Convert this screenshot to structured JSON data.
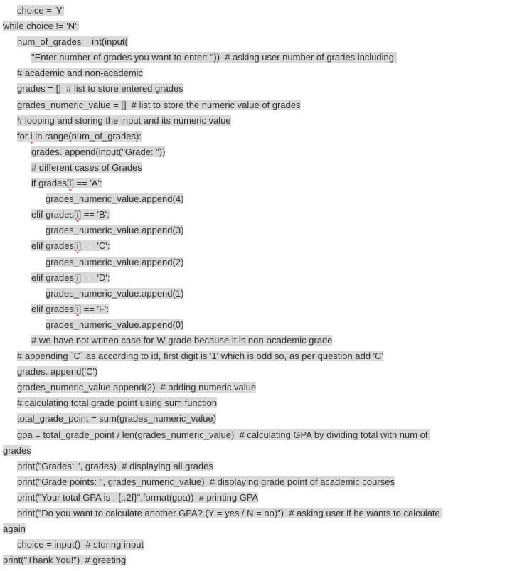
{
  "lines": [
    {
      "indent": 1,
      "text": "choice = 'Y'"
    },
    {
      "indent": 0,
      "text": "while choice != 'N':"
    },
    {
      "indent": 1,
      "text": "num_of_grades = int(input("
    },
    {
      "indent": 2,
      "text": "\"Enter number of grades you want to enter: \"))  # asking user number of grades including "
    },
    {
      "indent": 1,
      "text": "# academic and non-academic"
    },
    {
      "indent": 1,
      "text": "grades = []  # list to store entered grades"
    },
    {
      "indent": 1,
      "text": "grades_numeric_value = []  # list to store the numeric value of grades"
    },
    {
      "indent": 1,
      "text": "# looping and storing the input and its numeric value"
    },
    {
      "indent": 1,
      "text": "for i in range(num_of_grades):",
      "spellIdx": 4
    },
    {
      "indent": 2,
      "text": "grades. append(input(\"Grade: \"))"
    },
    {
      "indent": 2,
      "text": "# different cases of Grades"
    },
    {
      "indent": 2,
      "text": "if grades[i] == 'A':",
      "spellIdx": 10
    },
    {
      "indent": 3,
      "text": "grades_numeric_value.append(4)"
    },
    {
      "indent": 2,
      "text": "elif grades[i] == 'B':",
      "spellIdx": 12
    },
    {
      "indent": 3,
      "text": "grades_numeric_value.append(3)"
    },
    {
      "indent": 2,
      "text": "elif grades[i] == 'C':",
      "spellIdx": 12
    },
    {
      "indent": 3,
      "text": "grades_numeric_value.append(2)"
    },
    {
      "indent": 2,
      "text": "elif grades[i] == 'D':",
      "spellIdx": 12
    },
    {
      "indent": 3,
      "text": "grades_numeric_value.append(1)"
    },
    {
      "indent": 2,
      "text": "elif grades[i] == 'F':",
      "spellIdx": 12
    },
    {
      "indent": 3,
      "text": "grades_numeric_value.append(0)"
    },
    {
      "indent": 2,
      "text": "# we have not written case for W grade because it is non-academic grade"
    },
    {
      "indent": 1,
      "text": "# appending `C` as according to id, first digit is '1' which is odd so, as per question add 'C'"
    },
    {
      "indent": 1,
      "text": "grades. append('C')"
    },
    {
      "indent": 1,
      "text": "grades_numeric_value.append(2)  # adding numeric value"
    },
    {
      "indent": 1,
      "text": "# calculating total grade point using sum function"
    },
    {
      "indent": 1,
      "text": "total_grade_point = sum(grades_numeric_value)"
    },
    {
      "indent": 1,
      "text": "gpa = total_grade_point / len(grades_numeric_value)  # calculating GPA by dividing total with num of "
    },
    {
      "indent": 0,
      "text": "grades"
    },
    {
      "indent": 1,
      "text": "print(\"Grades: \", grades)  # displaying all grades"
    },
    {
      "indent": 1,
      "text": "print(\"Grade points: \", grades_numeric_value)  # displaying grade point of academic courses"
    },
    {
      "indent": 1,
      "text": "print(\"Your total GPA is : {:.2f}\".format(gpa))  # printing GPA"
    },
    {
      "indent": 1,
      "text": "print(\"Do you want to calculate another GPA? (Y = yes / N = no)\")  # asking user if he wants to calculate "
    },
    {
      "indent": 0,
      "text": "again"
    },
    {
      "indent": 1,
      "text": "choice = input()  # storing input"
    },
    {
      "indent": 0,
      "text": "print(\"Thank You!\")  # greeting"
    }
  ]
}
